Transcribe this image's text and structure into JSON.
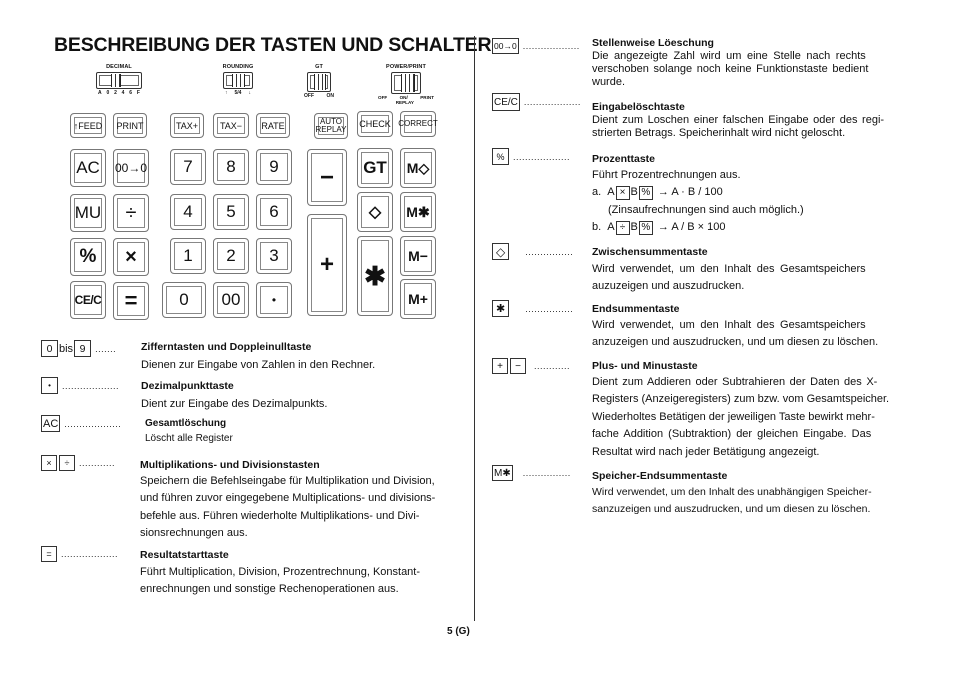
{
  "title": "BESCHREIBUNG DER TASTEN UND SCHALTER",
  "page_number": "5 (G)",
  "switches": [
    {
      "id": "decimal",
      "label": "DECIMAL",
      "positions": [
        "A",
        "0",
        "2",
        "4",
        "6",
        "F"
      ]
    },
    {
      "id": "rounding",
      "label": "ROUNDING",
      "positions": [
        "↑",
        "5/4",
        "↓"
      ]
    },
    {
      "id": "gt",
      "label": "GT",
      "positions": [
        "OFF",
        "ON"
      ]
    },
    {
      "id": "power",
      "label": "POWER/PRINT",
      "positions": [
        "OFF",
        "ON/ REPLAY",
        "PRINT"
      ]
    }
  ],
  "keys": {
    "feed": "↑FEED",
    "print": "PRINT",
    "tax_plus": "TAX+",
    "tax_minus": "TAX−",
    "rate": "RATE",
    "auto_replay_1": "AUTO",
    "auto_replay_2": "REPLAY",
    "check": "CHECK",
    "correct": "CORRECT",
    "ac": "AC",
    "zero_shift": "00→0",
    "seven": "7",
    "eight": "8",
    "nine": "9",
    "minus": "−",
    "gt": "GT",
    "m_diamond": "M◇",
    "mu": "MU",
    "divide": "÷",
    "four": "4",
    "five": "5",
    "six": "6",
    "diamond": "◇",
    "m_star": "M✱",
    "percent": "%",
    "multiply": "×",
    "one": "1",
    "two": "2",
    "three": "3",
    "plus": "+",
    "star": "✱",
    "m_minus": "M−",
    "ce_c": "CE/C",
    "equals": "=",
    "zero": "0",
    "double_zero": "00",
    "dot": "•",
    "m_plus": "M+"
  },
  "legend_left": [
    {
      "keys": [
        "0",
        "9"
      ],
      "joiner": "bis",
      "dots": ".......",
      "title": "Zifferntasten und Doppleinulltaste",
      "body": "Dienen zur Eingabe von Zahlen in den Rechner."
    },
    {
      "keys": [
        "•"
      ],
      "dots": "...................",
      "title": "Dezimalpunkttaste",
      "body": "Dient zur Eingabe des Dezimalpunkts."
    },
    {
      "keys": [
        "AC"
      ],
      "dots": "...................",
      "title": "Gesamtlöschung",
      "body": "Löscht alle Register"
    },
    {
      "keys": [
        "×",
        "÷"
      ],
      "dots": "............",
      "title": "Multiplikations- und Divisionstasten",
      "body_lines": [
        "Speichern die Befehlseingabe für Multiplikation und Division,",
        "und führen zuvor eingegebene Multiplications- und divisions-",
        "befehle aus. Führen wiederholte Multiplikations- und Divi-",
        "sionsrechnungen aus."
      ]
    },
    {
      "keys": [
        "="
      ],
      "dots": "...................",
      "title": "Resultatstarttaste",
      "body_lines": [
        "Führt Multiplication, Division, Prozentrechnung, Konstant-",
        "enrechnungen und sonstige Rechenoperationen aus."
      ]
    }
  ],
  "legend_right": [
    {
      "keys": [
        "00→0"
      ],
      "dots": "...................",
      "title": "Stellenweise Löeschung",
      "body_lines": [
        "Die angezeigte Zahl wird um eine Stelle nach rechts",
        "verschoben solange noch keine Funktionstaste bedient",
        "wurde."
      ]
    },
    {
      "keys": [
        "CE/C"
      ],
      "dots": "...................",
      "title": "Eingabelöschtaste",
      "body_lines": [
        "Dient zum Loschen einer falschen Eingabe oder des regi-",
        "strierten Betrags. Speicherinhalt wird nicht geloscht."
      ]
    },
    {
      "keys": [
        "%"
      ],
      "dots": "...................",
      "title": "Prozenttaste",
      "body": "Führt Prozentrechnungen aus.",
      "formula_a": {
        "prefix": "a.",
        "a": "A",
        "op": "×",
        "b": "B",
        "pct": "%",
        "result": "→ A · B / 100"
      },
      "note": "(Zinsaufrechnungen sind auch möglich.)",
      "formula_b": {
        "prefix": "b.",
        "a": "A",
        "op": "÷",
        "b": "B",
        "pct": "%",
        "result": "→ A / B × 100"
      }
    },
    {
      "keys": [
        "◇"
      ],
      "dots": "................",
      "title": "Zwischensummentaste",
      "body_lines": [
        "Wird verwendet, um den Inhalt des Gesamtspeichers",
        "auzuzeigen und auszudrucken."
      ]
    },
    {
      "keys": [
        "✱"
      ],
      "dots": "................",
      "title": "Endsummentaste",
      "body_lines": [
        "Wird verwendet, um den Inhalt des Gesamtspeichers",
        "anzuzeigen und auszudrucken, und um diesen zu löschen."
      ]
    },
    {
      "keys": [
        "+",
        "−"
      ],
      "dots": "............",
      "title": "Plus- und Minustaste",
      "body_lines": [
        "Dient zum Addieren oder Subtrahieren der Daten des X-",
        "Registers (Anzeigeregisters) zum bzw. vom Gesamtspeicher.",
        "Wiederholtes Betätigen der jeweiligen Taste bewirkt mehr-",
        "fache Addition (Subtraktion) der gleichen Eingabe. Das",
        "Resultat wird nach jeder Betätigung angezeigt."
      ]
    },
    {
      "keys": [
        "M✱"
      ],
      "dots": "................",
      "title": "Speicher-Endsummentaste",
      "body_lines": [
        "Wird verwendet, um den Inhalt des unabhängigen Speicher-",
        "sanzuzeigen und auszudrucken, und um diesen zu löschen."
      ]
    }
  ]
}
